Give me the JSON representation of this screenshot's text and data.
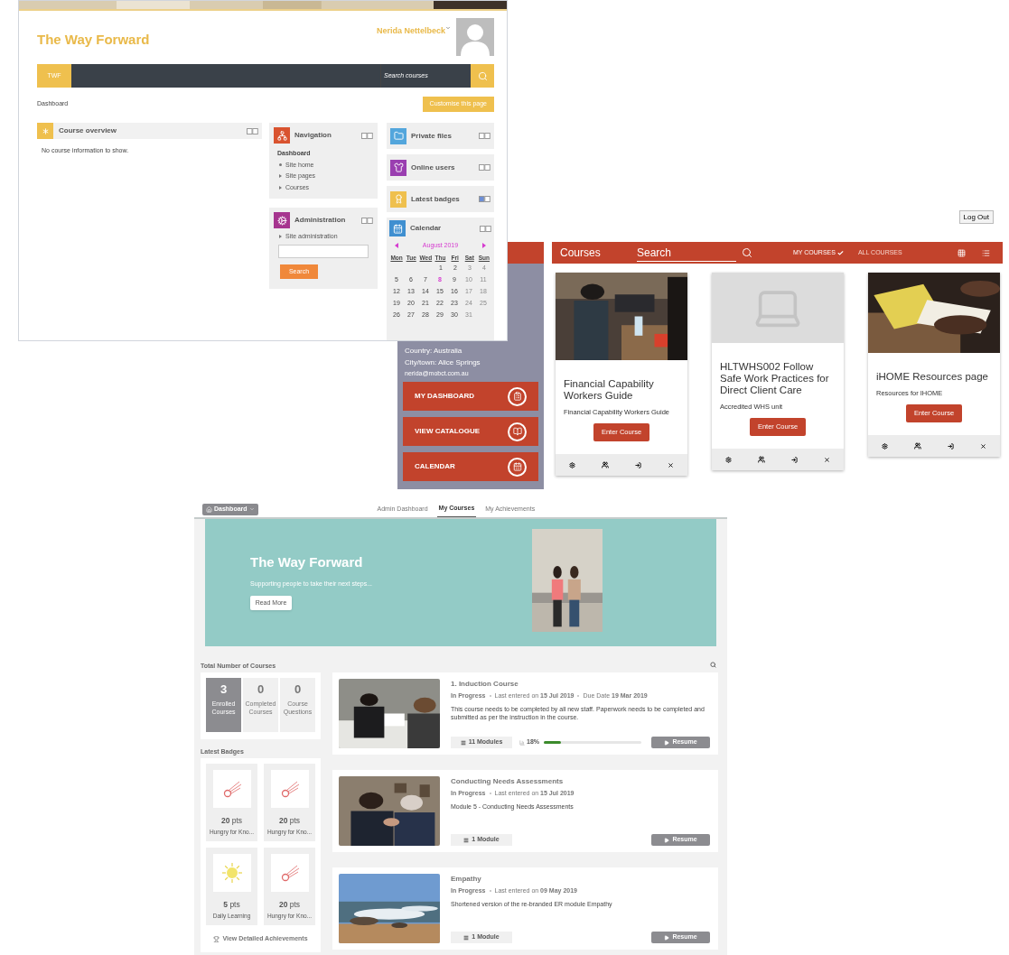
{
  "dashboard_screen": {
    "site_title": "The Way Forward",
    "user_name": "Nerida Nettelbeck",
    "nav_brand": "TWF",
    "search_placeholder": "Search courses",
    "breadcrumb": "Dashboard",
    "customise_button": "Customise this page",
    "course_overview": {
      "title": "Course overview",
      "message": "No course information to show."
    },
    "navigation": {
      "title": "Navigation",
      "heading": "Dashboard",
      "items": [
        {
          "label": "Site home",
          "kind": "leaf"
        },
        {
          "label": "Site pages",
          "kind": "branch"
        },
        {
          "label": "Courses",
          "kind": "branch"
        }
      ]
    },
    "administration": {
      "title": "Administration",
      "items": [
        {
          "label": "Site administration"
        }
      ],
      "search_button": "Search"
    },
    "side_blocks": [
      {
        "title": "Private files",
        "kind": "folder"
      },
      {
        "title": "Online users",
        "kind": "users"
      },
      {
        "title": "Latest badges",
        "kind": "badge"
      }
    ],
    "calendar": {
      "title": "Calendar",
      "month": "August 2019",
      "weekdays": [
        "Mon",
        "Tue",
        "Wed",
        "Thu",
        "Fri",
        "Sat",
        "Sun"
      ],
      "weeks": [
        [
          {
            "d": "1",
            "today": false
          },
          {
            "d": "2",
            "today": false
          },
          {
            "d": "3",
            "today": false
          },
          {
            "d": "4",
            "today": false
          }
        ],
        [
          {
            "d": "5",
            "today": false
          },
          {
            "d": "6",
            "today": false
          },
          {
            "d": "7",
            "today": false
          },
          {
            "d": "8",
            "today": true
          },
          {
            "d": "9",
            "today": false
          },
          {
            "d": "10",
            "today": false
          },
          {
            "d": "11",
            "today": false
          }
        ],
        [
          {
            "d": "12",
            "today": false
          },
          {
            "d": "13",
            "today": false
          },
          {
            "d": "14",
            "today": false
          },
          {
            "d": "15",
            "today": false
          },
          {
            "d": "16",
            "today": false
          },
          {
            "d": "17",
            "today": false
          },
          {
            "d": "18",
            "today": false
          }
        ],
        [
          {
            "d": "19",
            "today": false
          },
          {
            "d": "20",
            "today": false
          },
          {
            "d": "21",
            "today": false
          },
          {
            "d": "22",
            "today": false
          },
          {
            "d": "23",
            "today": false
          },
          {
            "d": "24",
            "today": false
          },
          {
            "d": "25",
            "today": false
          }
        ],
        [
          {
            "d": "26",
            "today": false
          },
          {
            "d": "27",
            "today": false
          },
          {
            "d": "28",
            "today": false
          },
          {
            "d": "29",
            "today": false
          },
          {
            "d": "30",
            "today": false
          },
          {
            "d": "31",
            "today": false
          }
        ]
      ]
    }
  },
  "courses_screen": {
    "logout_button": "Log Out",
    "sidebar": {
      "country": "Country: Australia",
      "city": "City/town: Alice Springs",
      "email": "nerida@mobct.com.au",
      "buttons": [
        {
          "label": "MY DASHBOARD",
          "kind": "dashboard"
        },
        {
          "label": "VIEW CATALOGUE",
          "kind": "catalogue"
        },
        {
          "label": "CALENDAR",
          "kind": "calendar"
        }
      ]
    },
    "toolbar": {
      "title": "Courses",
      "search_placeholder": "Search",
      "filters": [
        {
          "label": "MY COURSES",
          "selected": true
        },
        {
          "label": "ALL COURSES",
          "selected": false
        }
      ],
      "views": [
        {
          "kind": "grid"
        },
        {
          "kind": "list"
        }
      ]
    },
    "courses": [
      {
        "title": "Financial Capability Workers Guide",
        "summary": "Financial Capability Workers Guide",
        "button": "Enter Course"
      },
      {
        "title": "HLTWHS002 Follow Safe Work Practices for Direct Client Care",
        "summary": "Accredited WHS unit",
        "button": "Enter Course",
        "kind": "placeholder"
      },
      {
        "title": "iHOME Resources page",
        "summary": "Resources for IHOME",
        "button": "Enter Course"
      }
    ]
  },
  "mycourses_screen": {
    "menu_button": "Dashboard",
    "tabs": [
      {
        "label": "Admin Dashboard",
        "selected": false
      },
      {
        "label": "My Courses",
        "selected": true
      },
      {
        "label": "My Achievements",
        "selected": false
      }
    ],
    "banner": {
      "title": "The Way Forward",
      "subtitle": "Supporting people to take their next steps...",
      "button": "Read More"
    },
    "total_label": "Total Number of Courses",
    "stats": [
      {
        "value": "3",
        "label": "Enrolled Courses",
        "selected": true
      },
      {
        "value": "0",
        "label": "Completed Courses",
        "selected": false
      },
      {
        "value": "0",
        "label": "Course Questions",
        "selected": false
      }
    ],
    "badges_label": "Latest Badges",
    "badges": [
      {
        "points": "20",
        "unit": "pts",
        "name": "Hungry for Kno...",
        "kind": "comet"
      },
      {
        "points": "20",
        "unit": "pts",
        "name": "Hungry for Kno...",
        "kind": "comet"
      },
      {
        "points": "5",
        "unit": "pts",
        "name": "Daily Learning",
        "kind": "sun"
      },
      {
        "points": "20",
        "unit": "pts",
        "name": "Hungry for Kno...",
        "kind": "comet"
      }
    ],
    "achievements_link": "View Detailed Achievements",
    "courses": [
      {
        "title": "1. Induction Course",
        "status": "In Progress",
        "meta": [
          "Last entered on **15 Jul 2019**",
          "Due Date **19 Mar 2019**"
        ],
        "description": "This course needs to be completed by all new staff.  Paperwork needs to be completed and submitted as per the instruction in the course.",
        "modules": "11 Modules",
        "progress": {
          "reading": "18%",
          "level": 0.18
        },
        "resume": "Resume"
      },
      {
        "title": "Conducting Needs Assessments",
        "status": "In Progress",
        "meta": [
          "Last entered on **15 Jul 2019**"
        ],
        "description": "Module 5 - Conducting Needs Assessments",
        "modules": "1 Module",
        "resume": "Resume"
      },
      {
        "title": "Empathy",
        "status": "In Progress",
        "meta": [
          "Last entered on **09 May 2019**"
        ],
        "description": "Shortened version of the re-branded ER module Empathy",
        "modules": "1 Module",
        "resume": "Resume"
      }
    ]
  }
}
